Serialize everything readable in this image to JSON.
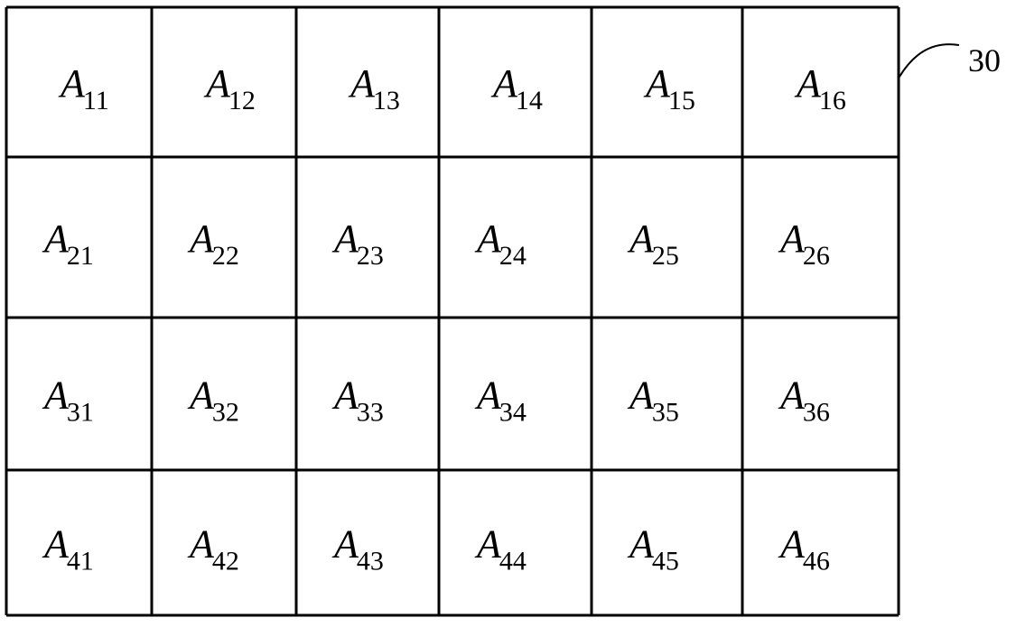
{
  "diagram": {
    "reference_numeral": "30",
    "rows": 4,
    "cols": 6,
    "cell_symbol": "A",
    "cells": [
      [
        "11",
        "12",
        "13",
        "14",
        "15",
        "16"
      ],
      [
        "21",
        "22",
        "23",
        "24",
        "25",
        "26"
      ],
      [
        "31",
        "32",
        "33",
        "34",
        "35",
        "36"
      ],
      [
        "41",
        "42",
        "43",
        "44",
        "45",
        "46"
      ]
    ],
    "line_color": "#000000",
    "background": "#ffffff"
  }
}
